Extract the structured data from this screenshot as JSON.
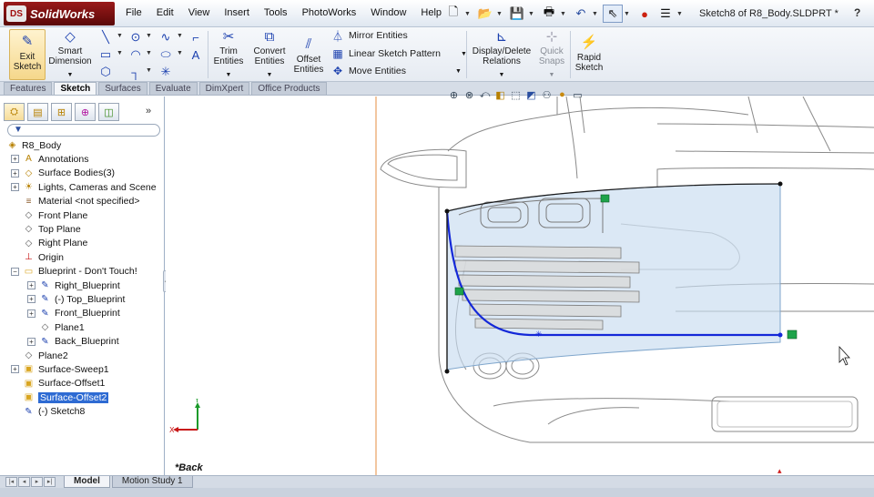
{
  "app": {
    "logo_text": "SolidWorks",
    "logo_badge": "DS",
    "document_title": "Sketch8 of R8_Body.SLDPRT *",
    "help_label": "?"
  },
  "menu": [
    "File",
    "Edit",
    "View",
    "Insert",
    "Tools",
    "PhotoWorks",
    "Window",
    "Help"
  ],
  "ribbon": {
    "exit_sketch": [
      "Exit",
      "Sketch"
    ],
    "smart_dimension": [
      "Smart",
      "Dimension"
    ],
    "trim_entities": [
      "Trim",
      "Entities"
    ],
    "convert_entities": [
      "Convert",
      "Entities"
    ],
    "offset_entities": [
      "Offset",
      "Entities"
    ],
    "mirror_entities": "Mirror Entities",
    "linear_sketch_pattern": "Linear Sketch Pattern",
    "move_entities": "Move Entities",
    "display_delete_relations": [
      "Display/Delete",
      "Relations"
    ],
    "quick_snaps": [
      "Quick",
      "Snaps"
    ],
    "rapid_sketch": [
      "Rapid",
      "Sketch"
    ]
  },
  "command_tabs": [
    "Features",
    "Sketch",
    "Surfaces",
    "Evaluate",
    "DimXpert",
    "Office Products"
  ],
  "active_command_tab": "Sketch",
  "panel_more": "»",
  "tree": [
    {
      "label": "R8_Body",
      "icon": "part-icon",
      "level": 0,
      "expander": ""
    },
    {
      "label": "Annotations",
      "icon": "annotations-icon",
      "level": 1,
      "expander": "+"
    },
    {
      "label": "Surface Bodies(3)",
      "icon": "surface-bodies-icon",
      "level": 1,
      "expander": "+"
    },
    {
      "label": "Lights, Cameras and Scene",
      "icon": "lights-icon",
      "level": 1,
      "expander": "+"
    },
    {
      "label": "Material <not specified>",
      "icon": "material-icon",
      "level": 1,
      "expander": ""
    },
    {
      "label": "Front Plane",
      "icon": "plane-icon",
      "level": 1,
      "expander": ""
    },
    {
      "label": "Top Plane",
      "icon": "plane-icon",
      "level": 1,
      "expander": ""
    },
    {
      "label": "Right Plane",
      "icon": "plane-icon",
      "level": 1,
      "expander": ""
    },
    {
      "label": "Origin",
      "icon": "origin-icon",
      "level": 1,
      "expander": ""
    },
    {
      "label": "Blueprint - Don't Touch!",
      "icon": "folder-icon",
      "level": 1,
      "expander": "−"
    },
    {
      "label": "Right_Blueprint",
      "icon": "sketch-icon",
      "level": 2,
      "expander": "+"
    },
    {
      "label": "(-) Top_Blueprint",
      "icon": "sketch-icon",
      "level": 2,
      "expander": "+"
    },
    {
      "label": "Front_Blueprint",
      "icon": "sketch-icon",
      "level": 2,
      "expander": "+"
    },
    {
      "label": "Plane1",
      "icon": "plane-icon",
      "level": 2,
      "expander": ""
    },
    {
      "label": "Back_Blueprint",
      "icon": "sketch-icon",
      "level": 2,
      "expander": "+"
    },
    {
      "label": "Plane2",
      "icon": "plane-icon",
      "level": 1,
      "expander": ""
    },
    {
      "label": "Surface-Sweep1",
      "icon": "surface-feature-icon",
      "level": 1,
      "expander": "+"
    },
    {
      "label": "Surface-Offset1",
      "icon": "surface-feature-icon",
      "level": 1,
      "expander": ""
    },
    {
      "label": "Surface-Offset2",
      "icon": "surface-feature-icon",
      "level": 1,
      "expander": "",
      "selected": true
    },
    {
      "label": "(-) Sketch8",
      "icon": "sketch-icon",
      "level": 1,
      "expander": ""
    }
  ],
  "viewport": {
    "view_name": "*Back",
    "triad_x": "X",
    "triad_y": "Y"
  },
  "bottom_tabs": [
    "Model",
    "Motion Study 1"
  ],
  "active_bottom_tab": "Model",
  "colors": {
    "sketch_line": "#1428d8",
    "selection": "#2e6bd3",
    "surface_fill": "#c8dcef",
    "logo_red": "#8a1212"
  }
}
